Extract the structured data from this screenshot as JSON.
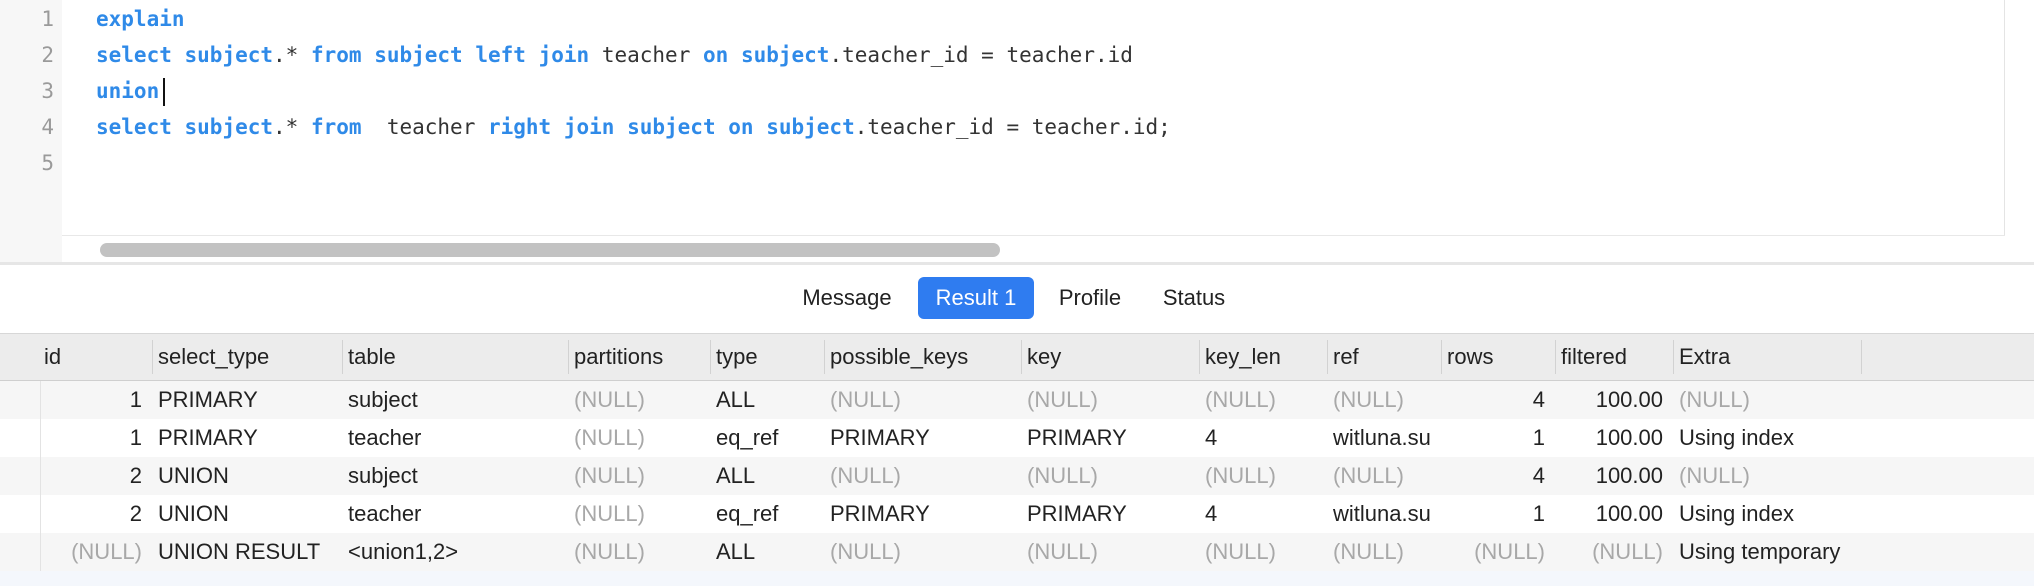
{
  "editor": {
    "line_numbers": [
      "1",
      "2",
      "3",
      "4",
      "5"
    ],
    "lines": [
      [
        {
          "t": "explain",
          "k": true
        }
      ],
      [
        {
          "t": "select",
          "k": true
        },
        {
          "t": " "
        },
        {
          "t": "subject",
          "k": true
        },
        {
          "t": ".* "
        },
        {
          "t": "from",
          "k": true
        },
        {
          "t": " "
        },
        {
          "t": "subject",
          "k": true
        },
        {
          "t": " "
        },
        {
          "t": "left",
          "k": true
        },
        {
          "t": " "
        },
        {
          "t": "join",
          "k": true
        },
        {
          "t": " teacher "
        },
        {
          "t": "on",
          "k": true
        },
        {
          "t": " "
        },
        {
          "t": "subject",
          "k": true
        },
        {
          "t": ".teacher_id = teacher.id"
        }
      ],
      [
        {
          "t": "union",
          "k": true
        }
      ],
      [
        {
          "t": "select",
          "k": true
        },
        {
          "t": " "
        },
        {
          "t": "subject",
          "k": true
        },
        {
          "t": ".* "
        },
        {
          "t": "from",
          "k": true
        },
        {
          "t": "  teacher "
        },
        {
          "t": "right",
          "k": true
        },
        {
          "t": " "
        },
        {
          "t": "join",
          "k": true
        },
        {
          "t": " "
        },
        {
          "t": "subject",
          "k": true
        },
        {
          "t": " "
        },
        {
          "t": "on",
          "k": true
        },
        {
          "t": " "
        },
        {
          "t": "subject",
          "k": true
        },
        {
          "t": ".teacher_id = teacher.id;"
        }
      ],
      []
    ],
    "cursor_line": 3
  },
  "tabs": {
    "message": "Message",
    "result1": "Result 1",
    "profile": "Profile",
    "status": "Status",
    "active": "result1"
  },
  "grid": {
    "columns": [
      "id",
      "select_type",
      "table",
      "partitions",
      "type",
      "possible_keys",
      "key",
      "key_len",
      "ref",
      "rows",
      "filtered",
      "Extra"
    ],
    "rows": [
      [
        "1",
        "PRIMARY",
        "subject",
        "(NULL)",
        "ALL",
        "(NULL)",
        "(NULL)",
        "(NULL)",
        "(NULL)",
        "4",
        "100.00",
        "(NULL)"
      ],
      [
        "1",
        "PRIMARY",
        "teacher",
        "(NULL)",
        "eq_ref",
        "PRIMARY",
        "PRIMARY",
        "4",
        "witluna.su",
        "1",
        "100.00",
        "Using index"
      ],
      [
        "2",
        "UNION",
        "subject",
        "(NULL)",
        "ALL",
        "(NULL)",
        "(NULL)",
        "(NULL)",
        "(NULL)",
        "4",
        "100.00",
        "(NULL)"
      ],
      [
        "2",
        "UNION",
        "teacher",
        "(NULL)",
        "eq_ref",
        "PRIMARY",
        "PRIMARY",
        "4",
        "witluna.su",
        "1",
        "100.00",
        "Using index"
      ],
      [
        "(NULL)",
        "UNION RESULT",
        "<union1,2>",
        "(NULL)",
        "ALL",
        "(NULL)",
        "(NULL)",
        "(NULL)",
        "(NULL)",
        "(NULL)",
        "(NULL)",
        "Using temporary"
      ]
    ]
  },
  "colors": {
    "keyword": "#2f8ae8",
    "active_tab": "#2f7cf0",
    "null_text": "#a8a8a8"
  }
}
